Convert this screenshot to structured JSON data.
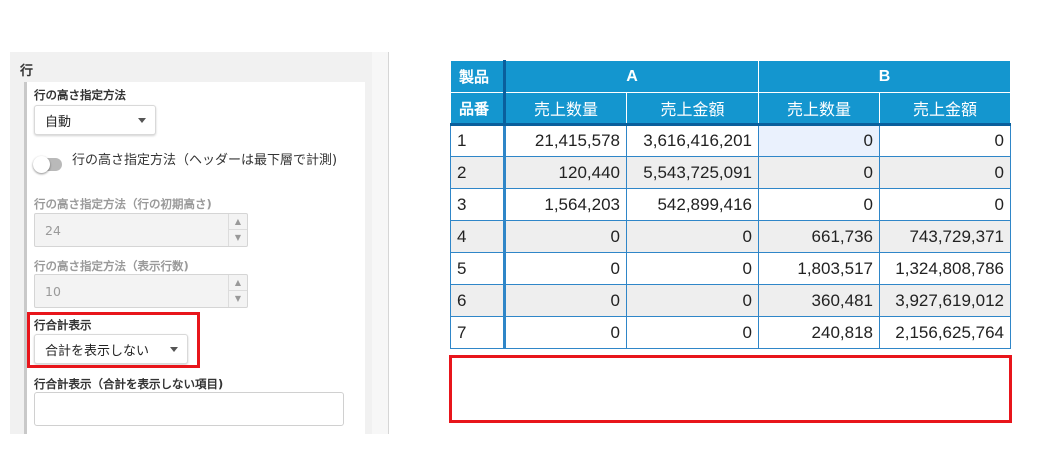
{
  "panel": {
    "section_title": "行",
    "row_height_method": {
      "label": "行の高さ指定方法",
      "value": "自動"
    },
    "header_toggle": {
      "label": "行の高さ指定方法（ヘッダーは最下層で計測)",
      "on": false
    },
    "initial_height": {
      "label": "行の高さ指定方法（行の初期高さ)",
      "value": "24"
    },
    "display_rows": {
      "label": "行の高さ指定方法（表示行数)",
      "value": "10"
    },
    "row_total": {
      "label": "行合計表示",
      "value": "合計を表示しない"
    },
    "row_total_exclude": {
      "label": "行合計表示（合計を表示しない項目)",
      "value": ""
    }
  },
  "table": {
    "row_header_top": "製品",
    "row_header_bottom": "品番",
    "groups": [
      "A",
      "B"
    ],
    "columns": [
      "売上数量",
      "売上金額",
      "売上数量",
      "売上金額"
    ],
    "rows": [
      {
        "key": "1",
        "cells": [
          "21,415,578",
          "3,616,416,201",
          "0",
          "0"
        ]
      },
      {
        "key": "2",
        "cells": [
          "120,440",
          "5,543,725,091",
          "0",
          "0"
        ]
      },
      {
        "key": "3",
        "cells": [
          "1,564,203",
          "542,899,416",
          "0",
          "0"
        ]
      },
      {
        "key": "4",
        "cells": [
          "0",
          "0",
          "661,736",
          "743,729,371"
        ]
      },
      {
        "key": "5",
        "cells": [
          "0",
          "0",
          "1,803,517",
          "1,324,808,786"
        ]
      },
      {
        "key": "6",
        "cells": [
          "0",
          "0",
          "360,481",
          "3,927,619,012"
        ]
      },
      {
        "key": "7",
        "cells": [
          "0",
          "0",
          "240,818",
          "2,156,625,764"
        ]
      }
    ]
  },
  "colors": {
    "header_blue": "#1496cf",
    "grid_border": "#2f86c8",
    "highlight_red": "#e8151b"
  },
  "icons": [
    "caret-down-icon",
    "spin-up-icon",
    "spin-down-icon",
    "toggle-switch"
  ]
}
